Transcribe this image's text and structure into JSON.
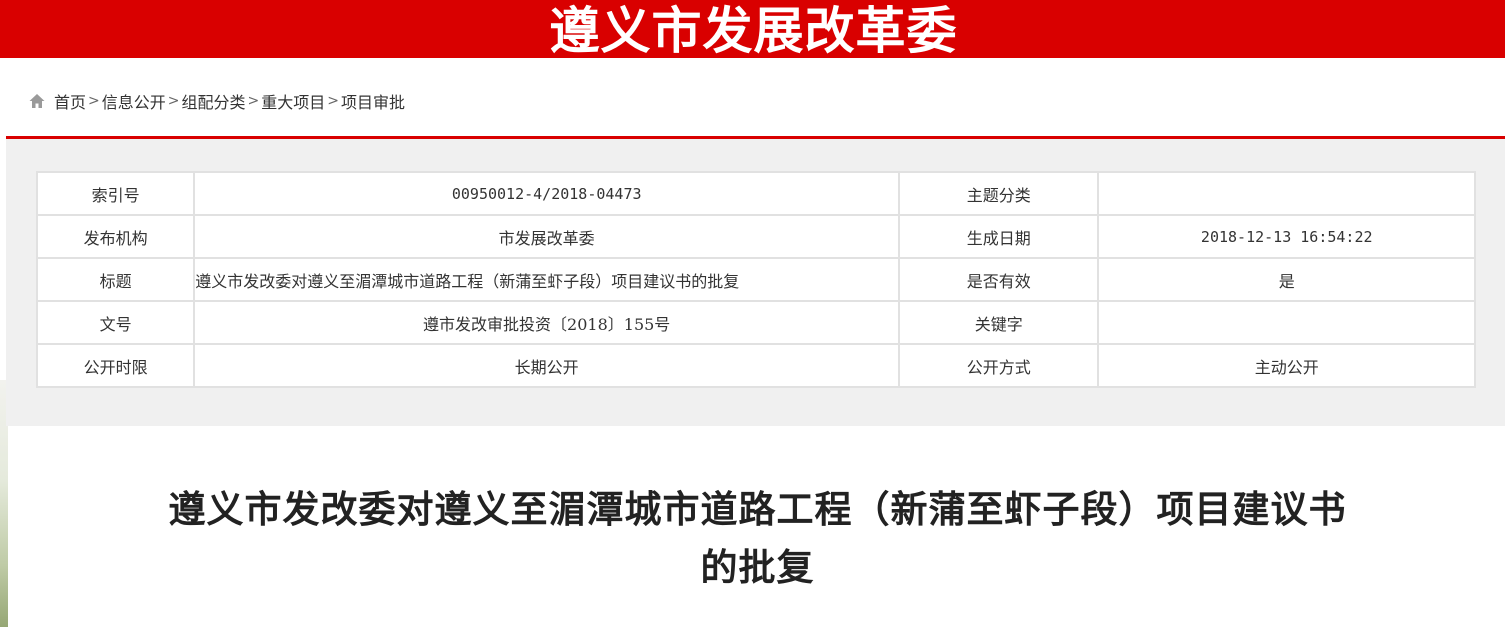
{
  "header": {
    "site_title": "遵义市发展改革委"
  },
  "breadcrumb": {
    "items": [
      "首页",
      "信息公开",
      "组配分类",
      "重大项目",
      "项目审批"
    ],
    "separator": ">"
  },
  "meta": {
    "rows": [
      {
        "label1": "索引号",
        "value1": "00950012-4/2018-04473",
        "label2": "主题分类",
        "value2": ""
      },
      {
        "label1": "发布机构",
        "value1": "市发展改革委",
        "label2": "生成日期",
        "value2": "2018-12-13 16:54:22"
      },
      {
        "label1": "标题",
        "value1": "遵义市发改委对遵义至湄潭城市道路工程（新蒲至虾子段）项目建议书的批复",
        "label2": "是否有效",
        "value2": "是"
      },
      {
        "label1": "文号",
        "value1": "遵市发改审批投资〔2018〕155号",
        "label2": "关键字",
        "value2": ""
      },
      {
        "label1": "公开时限",
        "value1": "长期公开",
        "label2": "公开方式",
        "value2": "主动公开"
      }
    ]
  },
  "article": {
    "title_line1": "遵义市发改委对遵义至湄潭城市道路工程（新蒲至虾子段）项目建议书",
    "title_line2": "的批复"
  },
  "colors": {
    "brand_red": "#d90000",
    "panel_bg": "#f0f0f0",
    "table_border": "#e1e1e1"
  },
  "icons": {
    "home": "home-icon"
  }
}
